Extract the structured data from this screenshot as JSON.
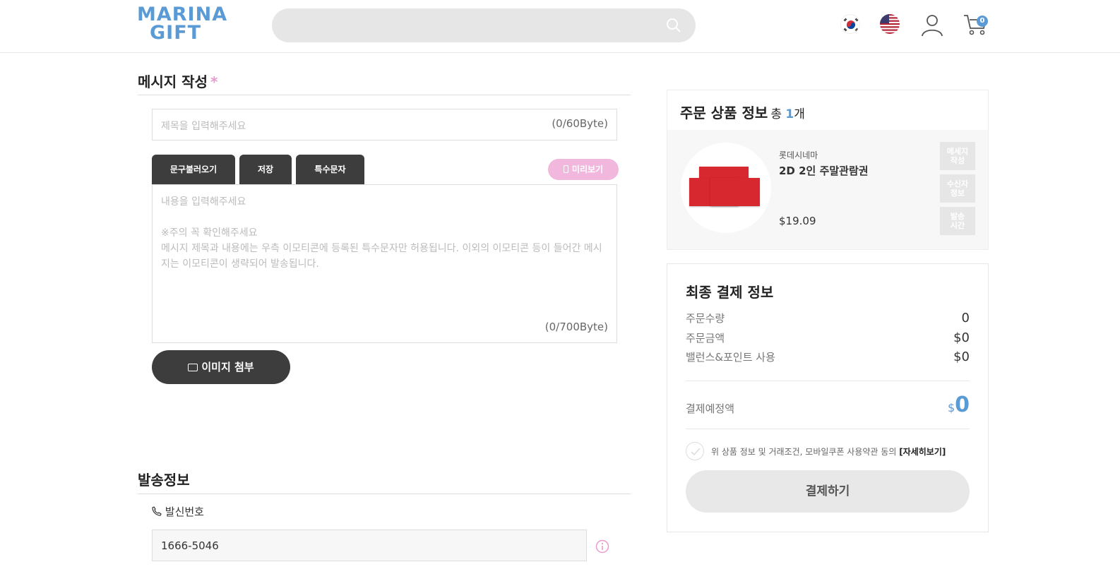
{
  "header": {
    "logo": {
      "line1": "MARINA",
      "line2": "GIFT"
    },
    "search_placeholder": "",
    "cart_count": "0"
  },
  "message": {
    "section_title": "메시지 작성",
    "required_mark": "*",
    "title_placeholder": "제목을 입력해주세요",
    "title_counter": "(0/60Byte)",
    "buttons": {
      "load_phrase": "문구불러오기",
      "save": "저장",
      "special_chars": "특수문자",
      "preview": "미리보기",
      "attach_image": "이미지 첨부"
    },
    "body_placeholder": "내용을 입력해주세요",
    "note_line1": "※주의 꼭 확인해주세요",
    "note_line2": "메시지 제목과 내용에는 우측 이모티콘에 등록된 특수문자만 허용됩니다. 이외의 이모티콘 등이 들어간 메시지는 이모티콘이 생략되어 발송됩니다.",
    "body_counter": "(0/700Byte)"
  },
  "send_info": {
    "section_title": "발송정보",
    "sender_label": "발신번호",
    "sender_number": "1666-5046"
  },
  "order": {
    "title": "주문 상품 정보",
    "total_prefix": "총",
    "total_count": "1",
    "total_suffix": "개",
    "product": {
      "brand": "롯데시네마",
      "name": "2D 2인 주말관람권",
      "price": "$19.09"
    },
    "side_tags": [
      "메세지\n작성",
      "수신자\n정보",
      "발송\n시간"
    ]
  },
  "payment": {
    "title": "최종 결제 정보",
    "rows": [
      {
        "label": "주문수량",
        "value": "0"
      },
      {
        "label": "주문금액",
        "value": "$0"
      },
      {
        "label": "밸런스&포인트 사용",
        "value": "$0"
      }
    ],
    "expected_label": "결제예정액",
    "expected_currency": "$",
    "expected_amount": "0",
    "agree_text": "위 상품 정보 및 거래조건, 모바일쿠폰 사용약관 동의",
    "agree_link": "[자세히보기]",
    "pay_button": "결제하기"
  },
  "colors": {
    "brand_blue": "#5b9bd5",
    "pink_accent": "#f1b7dd",
    "dark_button": "#3d3d3d"
  }
}
